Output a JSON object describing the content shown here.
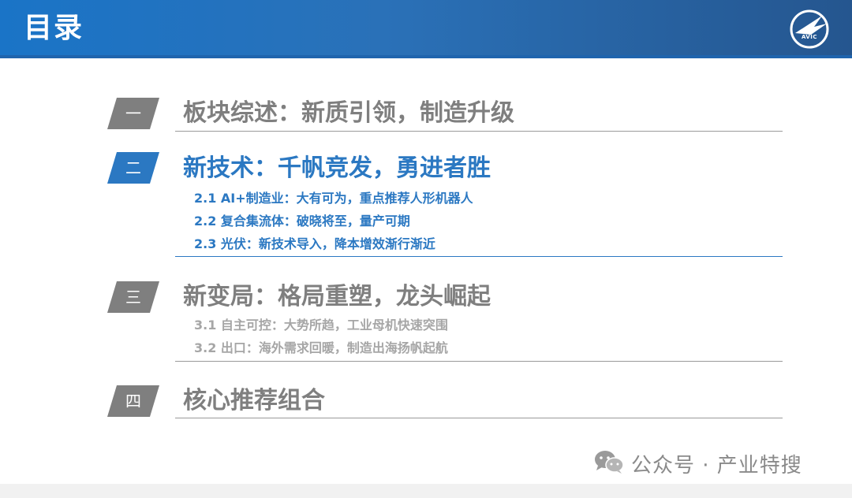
{
  "header": {
    "title": "目录",
    "logo_text": "AVIC",
    "logo_icon": "avic-logo-icon"
  },
  "sections": [
    {
      "badge": "一",
      "title": "板块综述：新质引领，制造升级",
      "subitems": []
    },
    {
      "badge": "二",
      "title": "新技术：千帆竞发，勇进者胜",
      "subitems": [
        "2.1 AI+制造业：大有可为，重点推荐人形机器人",
        "2.2 复合集流体：破晓将至，量产可期",
        "2.3 光伏：新技术导入，降本增效渐行渐近"
      ]
    },
    {
      "badge": "三",
      "title": "新变局：格局重塑，龙头崛起",
      "subitems": [
        "3.1 自主可控：大势所趋，工业母机快速突围",
        "3.2 出口：海外需求回暖，制造出海扬帆起航"
      ]
    },
    {
      "badge": "四",
      "title": "核心推荐组合",
      "subitems": []
    }
  ],
  "watermark": {
    "icon": "wechat-icon",
    "text": "公众号 · 产业特搜"
  },
  "colors": {
    "accent": "#2b78c2",
    "muted": "#7f7f7f",
    "header": "#1a74c7"
  }
}
